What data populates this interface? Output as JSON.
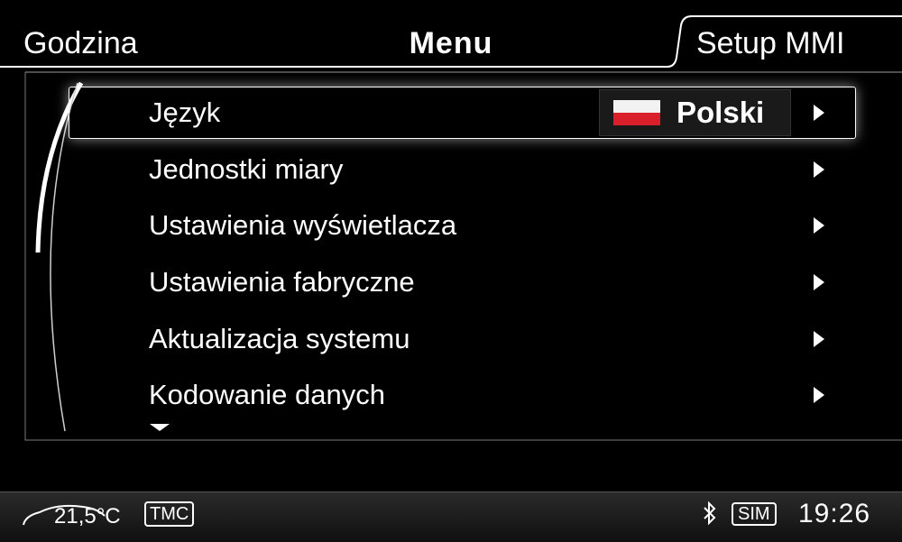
{
  "tabs": {
    "left": "Godzina",
    "center": "Menu",
    "right": "Setup MMI"
  },
  "menu": {
    "items": [
      {
        "label": "Język"
      },
      {
        "label": "Jednostki miary"
      },
      {
        "label": "Ustawienia wyświetlacza"
      },
      {
        "label": "Ustawienia fabryczne"
      },
      {
        "label": "Aktualizacja systemu"
      },
      {
        "label": "Kodowanie danych"
      }
    ],
    "selected_value": "Polski",
    "selected_flag": "poland-flag-icon"
  },
  "status": {
    "temperature": "21,5°C",
    "tmc": "TMC",
    "bluetooth": "bluetooth-icon",
    "sim": "SIM",
    "time": "19:26"
  },
  "colors": {
    "background": "#000000",
    "text": "#ffffff",
    "flag_red": "#d9202a"
  }
}
